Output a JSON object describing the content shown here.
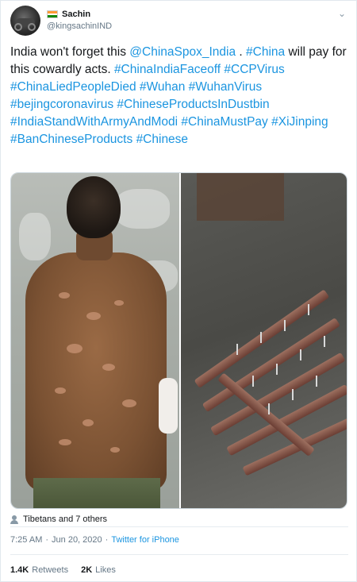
{
  "user": {
    "name": "Sachin",
    "handle": "@kingsachinIND",
    "flag_icon": "india-flag-icon"
  },
  "tweet": {
    "segments": [
      {
        "text": "India won't forget this ",
        "link": false
      },
      {
        "text": "@ChinaSpox_India",
        "link": true
      },
      {
        "text": " . ",
        "link": false
      },
      {
        "text": "#China",
        "link": true
      },
      {
        "text": " will pay for this cowardly acts. ",
        "link": false
      },
      {
        "text": "#ChinaIndiaFaceoff",
        "link": true
      },
      {
        "text": " ",
        "link": false
      },
      {
        "text": "#CCPVirus",
        "link": true
      },
      {
        "text": " ",
        "link": false
      },
      {
        "text": "#ChinaLiedPeopleDied",
        "link": true
      },
      {
        "text": " ",
        "link": false
      },
      {
        "text": "#Wuhan",
        "link": true
      },
      {
        "text": " ",
        "link": false
      },
      {
        "text": "#WuhanVirus",
        "link": true
      },
      {
        "text": " ",
        "link": false
      },
      {
        "text": "#bejingcoronavirus",
        "link": true
      },
      {
        "text": " ",
        "link": false
      },
      {
        "text": "#ChineseProductsInDustbin",
        "link": true
      },
      {
        "text": " ",
        "link": false
      },
      {
        "text": "#IndiaStandWithArmyAndModi",
        "link": true
      },
      {
        "text": " ",
        "link": false
      },
      {
        "text": "#ChinaMustPay",
        "link": true
      },
      {
        "text": " ",
        "link": false
      },
      {
        "text": "#XiJinping",
        "link": true
      },
      {
        "text": " ",
        "link": false
      },
      {
        "text": "#BanChineseProducts",
        "link": true
      },
      {
        "text": " ",
        "link": false
      },
      {
        "text": "#Chinese",
        "link": true
      }
    ]
  },
  "liked_by": "Tibetans and 7 others",
  "meta": {
    "time": "7:25 AM",
    "separator": "·",
    "date": "Jun 20, 2020",
    "source": "Twitter for iPhone"
  },
  "stats": {
    "retweets_count": "1.4K",
    "retweets_label": "Retweets",
    "likes_count": "2K",
    "likes_label": "Likes"
  },
  "colors": {
    "link": "#1b95e0",
    "text": "#14171a",
    "muted": "#657786"
  }
}
